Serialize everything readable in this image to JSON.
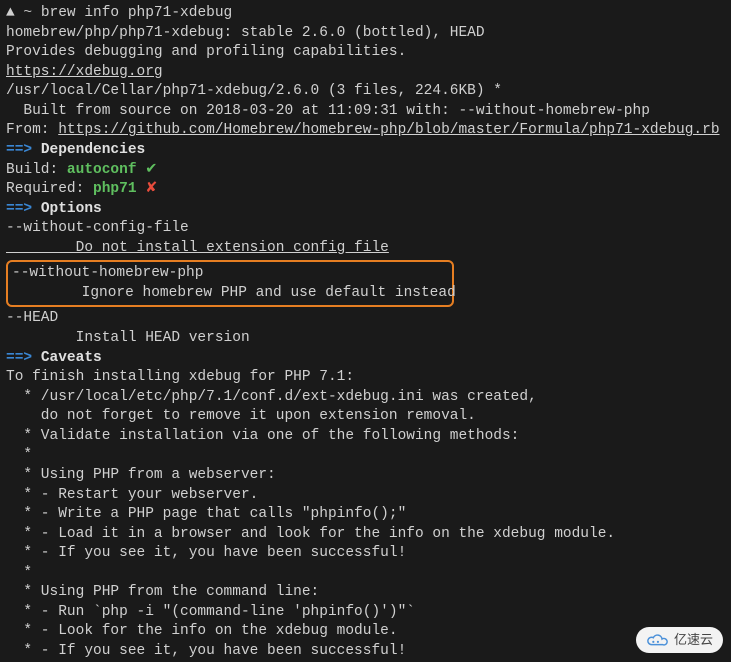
{
  "prompt": {
    "arrow": "▲",
    "tilde": "~",
    "command": "brew info php71-xdebug"
  },
  "output": {
    "package_line": "homebrew/php/php71-xdebug: stable 2.6.0 (bottled), HEAD",
    "description": "Provides debugging and profiling capabilities.",
    "url": "https://xdebug.org",
    "install_path": "/usr/local/Cellar/php71-xdebug/2.6.0 (3 files, 224.6KB) *",
    "built_from": "  Built from source on 2018-03-20 at 11:09:31 with: --without-homebrew-php",
    "from_label": "From: ",
    "from_url": "https://github.com/Homebrew/homebrew-php/blob/master/Formula/php71-xdebug.rb"
  },
  "sections": {
    "arrow": "==>",
    "dependencies": "Dependencies",
    "options": "Options",
    "caveats": "Caveats"
  },
  "deps": {
    "build_label": "Build: ",
    "autoconf": "autoconf",
    "check": " ✔",
    "required_label": "Required: ",
    "php71": "php71",
    "cross": " ✘"
  },
  "options": {
    "opt1": "--without-config-file",
    "opt1_desc": "        Do not install extension config file",
    "opt2": "--without-homebrew-php",
    "opt2_desc": "        Ignore homebrew PHP and use default instead",
    "opt3": "--HEAD",
    "opt3_desc": "        Install HEAD version"
  },
  "caveats": {
    "l1": "To finish installing xdebug for PHP 7.1:",
    "l2": "  * /usr/local/etc/php/7.1/conf.d/ext-xdebug.ini was created,",
    "l3": "    do not forget to remove it upon extension removal.",
    "l4": "  * Validate installation via one of the following methods:",
    "l5": "  *",
    "l6": "  * Using PHP from a webserver:",
    "l7": "  * - Restart your webserver.",
    "l8": "  * - Write a PHP page that calls \"phpinfo();\"",
    "l9": "  * - Load it in a browser and look for the info on the xdebug module.",
    "l10": "  * - If you see it, you have been successful!",
    "l11": "  *",
    "l12": "  * Using PHP from the command line:",
    "l13": "  * - Run `php -i \"(command-line 'phpinfo()')\"`",
    "l14": "  * - Look for the info on the xdebug module.",
    "l15": "  * - If you see it, you have been successful!"
  },
  "watermark": {
    "text": "亿速云"
  }
}
